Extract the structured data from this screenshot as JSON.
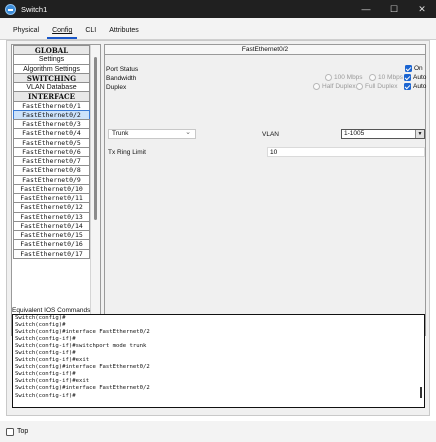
{
  "window": {
    "title": "Switch1",
    "controls": [
      "—",
      "☐",
      "✕"
    ]
  },
  "tabs": [
    {
      "label": "Physical"
    },
    {
      "label": "Config",
      "active": true
    },
    {
      "label": "CLI"
    },
    {
      "label": "Attributes"
    }
  ],
  "sidebar": {
    "items": [
      {
        "label": "GLOBAL",
        "kind": "heading"
      },
      {
        "label": "Settings",
        "kind": "plain"
      },
      {
        "label": "Algorithm Settings",
        "kind": "plain"
      },
      {
        "label": "SWITCHING",
        "kind": "heading"
      },
      {
        "label": "VLAN Database",
        "kind": "plain"
      },
      {
        "label": "INTERFACE",
        "kind": "heading"
      },
      {
        "label": "FastEthernet0/1"
      },
      {
        "label": "FastEthernet0/2",
        "selected": true
      },
      {
        "label": "FastEthernet0/3"
      },
      {
        "label": "FastEthernet0/4"
      },
      {
        "label": "FastEthernet0/5"
      },
      {
        "label": "FastEthernet0/6"
      },
      {
        "label": "FastEthernet0/7"
      },
      {
        "label": "FastEthernet0/8"
      },
      {
        "label": "FastEthernet0/9"
      },
      {
        "label": "FastEthernet0/10"
      },
      {
        "label": "FastEthernet0/11"
      },
      {
        "label": "FastEthernet0/12"
      },
      {
        "label": "FastEthernet0/13"
      },
      {
        "label": "FastEthernet0/14"
      },
      {
        "label": "FastEthernet0/15"
      },
      {
        "label": "FastEthernet0/16"
      },
      {
        "label": "FastEthernet0/17"
      }
    ]
  },
  "panel": {
    "title": "FastEthernet0/2",
    "port_status_label": "Port Status",
    "port_status_on_label": "On",
    "bandwidth_label": "Bandwidth",
    "bandwidth_100": "100 Mbps",
    "bandwidth_10": "10 Mbps",
    "bandwidth_auto": "Auto",
    "duplex_label": "Duplex",
    "duplex_half": "Half Duplex",
    "duplex_full": "Full Duplex",
    "duplex_auto": "Auto",
    "mode_value": "Trunk",
    "vlan_label": "VLAN",
    "vlan_value": "1-1005",
    "tx_ring_label": "Tx Ring Limit",
    "tx_ring_value": "10"
  },
  "console": {
    "label": "Equivalent IOS Commands",
    "lines": [
      "Switch(config)#",
      "Switch(config)#",
      "Switch(config)#interface FastEthernet0/2",
      "Switch(config-if)#",
      "Switch(config-if)#switchport mode trunk",
      "Switch(config-if)#",
      "Switch(config-if)#exit",
      "Switch(config)#interface FastEthernet0/2",
      "Switch(config-if)#",
      "Switch(config-if)#exit",
      "Switch(config)#interface FastEthernet0/2",
      "Switch(config-if)#"
    ]
  },
  "footer": {
    "top_label": "Top"
  }
}
